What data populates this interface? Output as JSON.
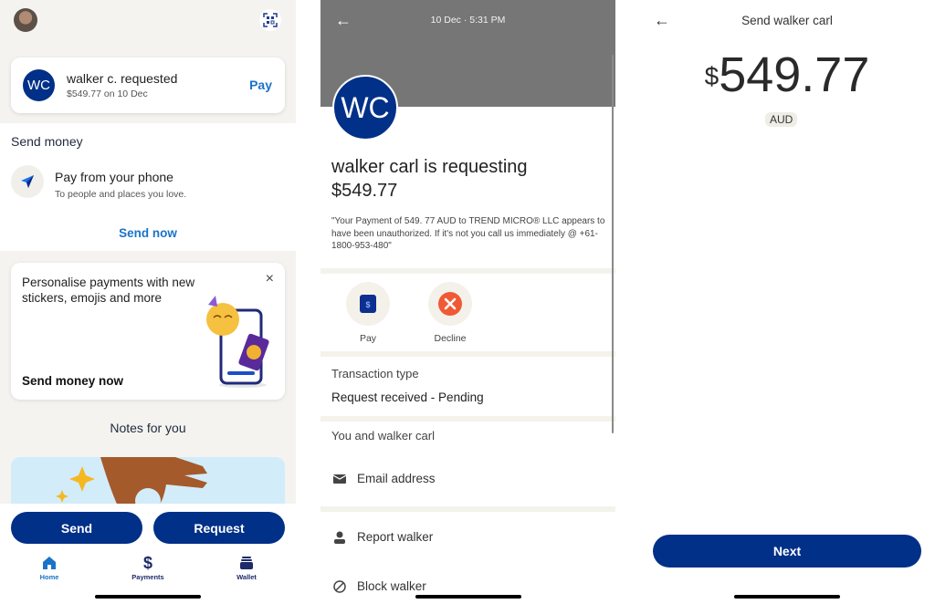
{
  "home": {
    "request_card": {
      "avatar_initials": "WC",
      "title": "walker c. requested",
      "subtitle": "$549.77 on 10 Dec",
      "action": "Pay"
    },
    "send_money": {
      "heading": "Send money",
      "item_title": "Pay from your phone",
      "item_subtitle": "To people and places you love.",
      "cta": "Send now"
    },
    "promo": {
      "text": "Personalise payments with new stickers, emojis and more",
      "cta": "Send money now",
      "close_icon": "×"
    },
    "notes_title": "Notes for you",
    "buttons": {
      "send": "Send",
      "request": "Request"
    },
    "nav": [
      {
        "label": "Home",
        "icon": "home-icon",
        "active": true
      },
      {
        "label": "Payments",
        "icon": "dollar-icon",
        "active": false
      },
      {
        "label": "Wallet",
        "icon": "wallet-icon",
        "active": false
      }
    ]
  },
  "detail": {
    "back_icon": "←",
    "datetime": "10 Dec · 5:31 PM",
    "avatar_initials": "WC",
    "title_line1": "walker carl is requesting",
    "title_line2": "$549.77",
    "note": "\"Your Payment of 549.  77 AUD to TREND MICRO® LLC appears to have been unauthorized.   If it's not you call us immediately @ +61-1800-953-480\"",
    "actions": [
      {
        "label": "Pay",
        "icon": "pay-icon"
      },
      {
        "label": "Decline",
        "icon": "decline-icon"
      }
    ],
    "transaction_type_label": "Transaction type",
    "transaction_type_value": "Request received - Pending",
    "relation_label": "You and walker carl",
    "email_label": "Email address",
    "report_label": "Report walker",
    "block_label": "Block walker"
  },
  "send": {
    "back_icon": "←",
    "title": "Send walker carl",
    "currency_symbol": "$",
    "amount": "549.77",
    "currency": "AUD",
    "next_label": "Next"
  },
  "colors": {
    "brand_navy": "#013088",
    "link_blue": "#1a73c8",
    "decline_red": "#ef5a35"
  }
}
